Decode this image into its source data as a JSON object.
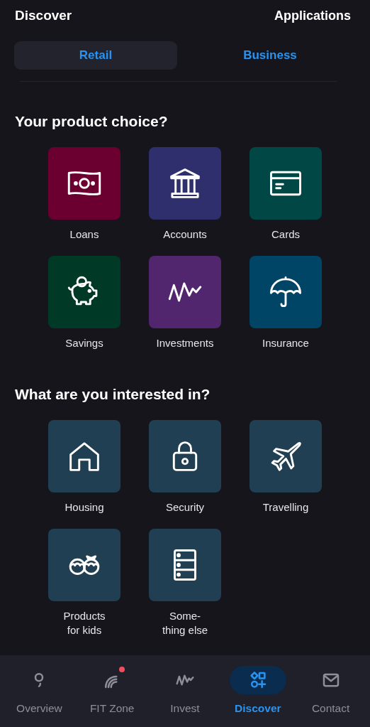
{
  "header": {
    "title": "Discover",
    "action": "Applications"
  },
  "tabs": [
    {
      "label": "Retail",
      "selected": true
    },
    {
      "label": "Business",
      "selected": false
    }
  ],
  "sections": [
    {
      "title": "Your product choice?",
      "tiles": [
        {
          "label": "Loans",
          "kind": "banknote",
          "color": "#6b0030"
        },
        {
          "label": "Accounts",
          "kind": "bank",
          "color": "#2f2f6e"
        },
        {
          "label": "Cards",
          "kind": "card",
          "color": "#004746"
        },
        {
          "label": "Savings",
          "kind": "piggy",
          "color": "#003a26"
        },
        {
          "label": "Investments",
          "kind": "chart",
          "color": "#52266e"
        },
        {
          "label": "Insurance",
          "kind": "umbrella",
          "color": "#004466"
        }
      ]
    },
    {
      "title": "What are you interested in?",
      "tiles": [
        {
          "label": "Housing",
          "kind": "house",
          "color": "#213f52"
        },
        {
          "label": "Security",
          "kind": "lock",
          "color": "#213f52"
        },
        {
          "label": "Travelling",
          "kind": "plane",
          "color": "#213f52"
        },
        {
          "label": "Products\nfor kids",
          "kind": "kids",
          "color": "#213f52"
        },
        {
          "label": "Some-\nthing else",
          "kind": "drawers",
          "color": "#213f52"
        }
      ]
    }
  ],
  "nav": [
    {
      "label": "Overview",
      "kind": "overview",
      "selected": false,
      "notification": false
    },
    {
      "label": "FIT Zone",
      "kind": "rainbow",
      "selected": false,
      "notification": true
    },
    {
      "label": "Invest",
      "kind": "chart",
      "selected": false,
      "notification": false
    },
    {
      "label": "Discover",
      "kind": "shapes",
      "selected": true,
      "notification": false
    },
    {
      "label": "Contact",
      "kind": "mail",
      "selected": false,
      "notification": false
    }
  ]
}
